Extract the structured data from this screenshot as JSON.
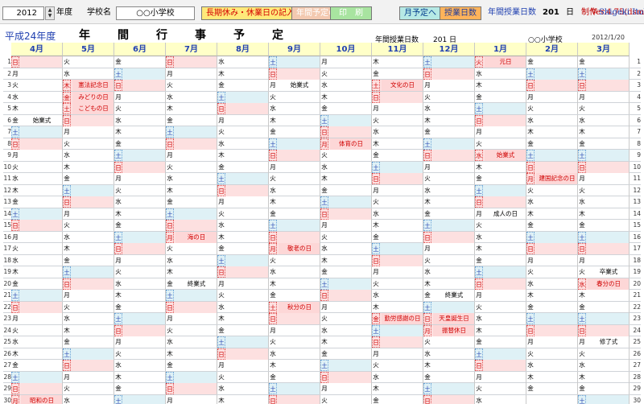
{
  "toolbar": {
    "year": "2012",
    "nendo": "年度",
    "school_label": "学校名",
    "school_name": "○○小学校",
    "btn_long": "長期休み・休業日の記入",
    "btn_save": "年間予定の保存",
    "btn_print": "印　刷",
    "btn_month": "月予定へ",
    "btn_days": "授業日数",
    "days_label": "年間授業日数",
    "days_value": "201",
    "days_unit": "日",
    "version": "Ver.4.75(dsm)",
    "author_label": "制作",
    "author": "Shigeki Itoh"
  },
  "header": {
    "subtitle": "平成24年度",
    "title": "年間行事予定",
    "days_text": "年間授業日数　　201 日",
    "school_text": "○○小学校",
    "date_text": "2012/1/20"
  },
  "months": [
    "4月",
    "5月",
    "6月",
    "7月",
    "8月",
    "9月",
    "10月",
    "11月",
    "12月",
    "1月",
    "2月",
    "3月"
  ],
  "start_weekday": [
    0,
    2,
    5,
    0,
    3,
    6,
    1,
    4,
    6,
    2,
    5,
    5
  ],
  "month_days": [
    30,
    31,
    30,
    31,
    31,
    30,
    31,
    30,
    31,
    31,
    29,
    31
  ],
  "weekday_names": [
    "日",
    "月",
    "火",
    "水",
    "木",
    "金",
    "土"
  ],
  "holidays": {
    "4": [
      29,
      30
    ],
    "5": [
      3,
      4,
      5
    ],
    "7": [
      16
    ],
    "9": [
      17,
      22
    ],
    "10": [
      8
    ],
    "11": [
      3,
      23
    ],
    "12": [
      23,
      24
    ],
    "1": [
      1,
      9
    ],
    "2": [
      11
    ],
    "3": [
      20
    ]
  },
  "events": {
    "4": {
      "6": "始業式",
      "30": "昭和の日"
    },
    "5": {
      "3": "憲法記念日",
      "4": "みどりの日",
      "5": "こどもの日"
    },
    "6": {},
    "7": {
      "16": "海の日",
      "20": "終業式"
    },
    "8": {},
    "9": {
      "3": "始業式",
      "17": "敬老の日",
      "22": "秋分の日"
    },
    "10": {
      "8": "体育の日"
    },
    "11": {
      "3": "文化の日",
      "23": "勤労感謝の日"
    },
    "12": {
      "21": "終業式",
      "23": "天皇誕生日",
      "24": "振替休日"
    },
    "1": {
      "1": "元日",
      "9": "始業式",
      "14": "成人の日"
    },
    "2": {
      "11": "建国記念の日"
    },
    "3": {
      "19": "卒業式",
      "20": "春分の日",
      "25": "修了式"
    }
  },
  "month_keys": [
    "4",
    "5",
    "6",
    "7",
    "8",
    "9",
    "10",
    "11",
    "12",
    "1",
    "2",
    "3"
  ]
}
